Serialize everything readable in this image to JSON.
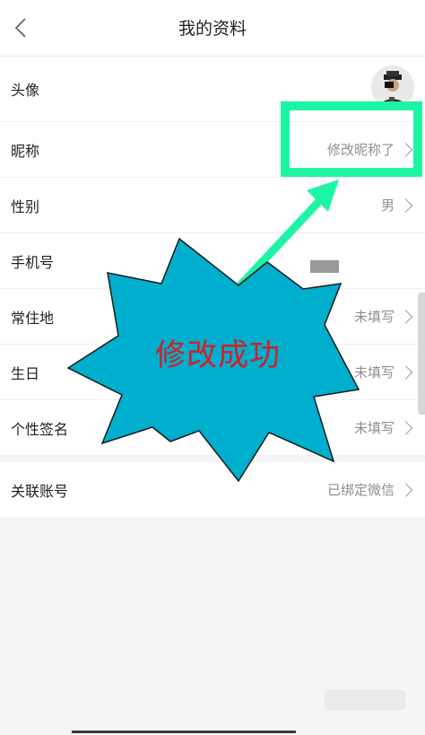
{
  "header": {
    "title": "我的资料"
  },
  "rows": [
    {
      "label": "头像",
      "value": ""
    },
    {
      "label": "昵称",
      "value": "修改昵称了"
    },
    {
      "label": "性别",
      "value": "男"
    },
    {
      "label": "手机号",
      "value": ""
    },
    {
      "label": "常住地",
      "value": "未填写"
    },
    {
      "label": "生日",
      "value": "未填写"
    },
    {
      "label": "个性签名",
      "value": "未填写"
    }
  ],
  "linked": {
    "label": "关联账号",
    "value": "已绑定微信"
  },
  "annotation": {
    "burst_text": "修改成功",
    "box_color": "#1df5a5",
    "burst_color": "#00aecd",
    "text_color": "#d0202a"
  },
  "icons": {
    "back": "chevron-left-icon",
    "row_arrow": "chevron-right-icon",
    "avatar": "avatar-image"
  }
}
